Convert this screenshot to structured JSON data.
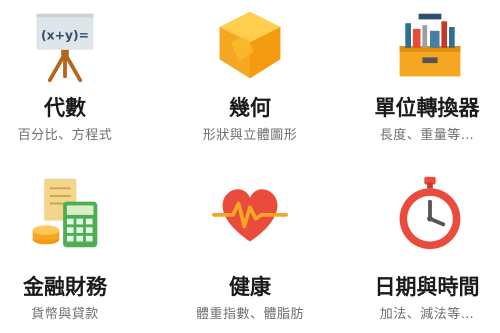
{
  "tiles": [
    {
      "title": "代數",
      "subtitle": "百分比、方程式",
      "icon": "algebra-board-icon",
      "icon_text": "(x+y)="
    },
    {
      "title": "幾何",
      "subtitle": "形狀與立體圖形",
      "icon": "geometry-cube-icon"
    },
    {
      "title": "單位轉換器",
      "subtitle": "長度、重量等…",
      "icon": "toolbox-icon"
    },
    {
      "title": "金融財務",
      "subtitle": "貨幣與貸款",
      "icon": "finance-calculator-icon"
    },
    {
      "title": "健康",
      "subtitle": "體重指數、體脂肪",
      "icon": "heart-pulse-icon"
    },
    {
      "title": "日期與時間",
      "subtitle": "加法、減法等…",
      "icon": "stopwatch-icon"
    }
  ],
  "colors": {
    "title": "#1a1a1a",
    "subtitle": "#6f6f6f",
    "accent_orange": "#f5a623",
    "accent_red": "#e94b3c",
    "accent_blue": "#2f6f8f",
    "accent_green": "#4caf50"
  }
}
